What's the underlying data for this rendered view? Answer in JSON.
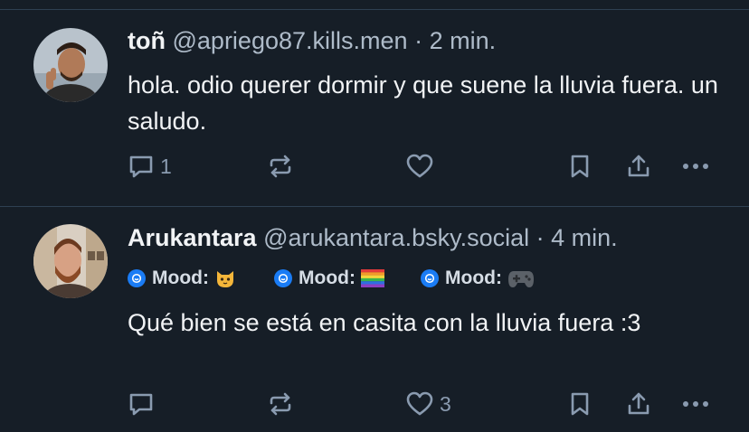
{
  "posts": [
    {
      "author": "toñ",
      "handle": "@apriego87.kills.men",
      "separator": "·",
      "time": "2 min.",
      "text": "hola. odio querer dormir y que suene la lluvia fuera. un saludo.",
      "reply_count": "1",
      "like_count": ""
    },
    {
      "author": "Arukantara",
      "handle": "@arukantara.bsky.social",
      "separator": "·",
      "time": "4 min.",
      "badges": [
        {
          "label": "Mood:",
          "emoji": "cat-emoji"
        },
        {
          "label": "Mood:",
          "emoji": "rainbow-flag-emoji"
        },
        {
          "label": "Mood:",
          "emoji": "game-controller-emoji"
        }
      ],
      "text": "Qué bien se está en casita con la lluvia fuera :3",
      "reply_count": "",
      "like_count": "3"
    }
  ],
  "colors": {
    "background": "#161e27",
    "divider": "#2e4052",
    "text": "#f1f3f5",
    "muted": "#aebbc9",
    "icon": "#8a9bb0",
    "badge_blue": "#1a7cf5"
  }
}
